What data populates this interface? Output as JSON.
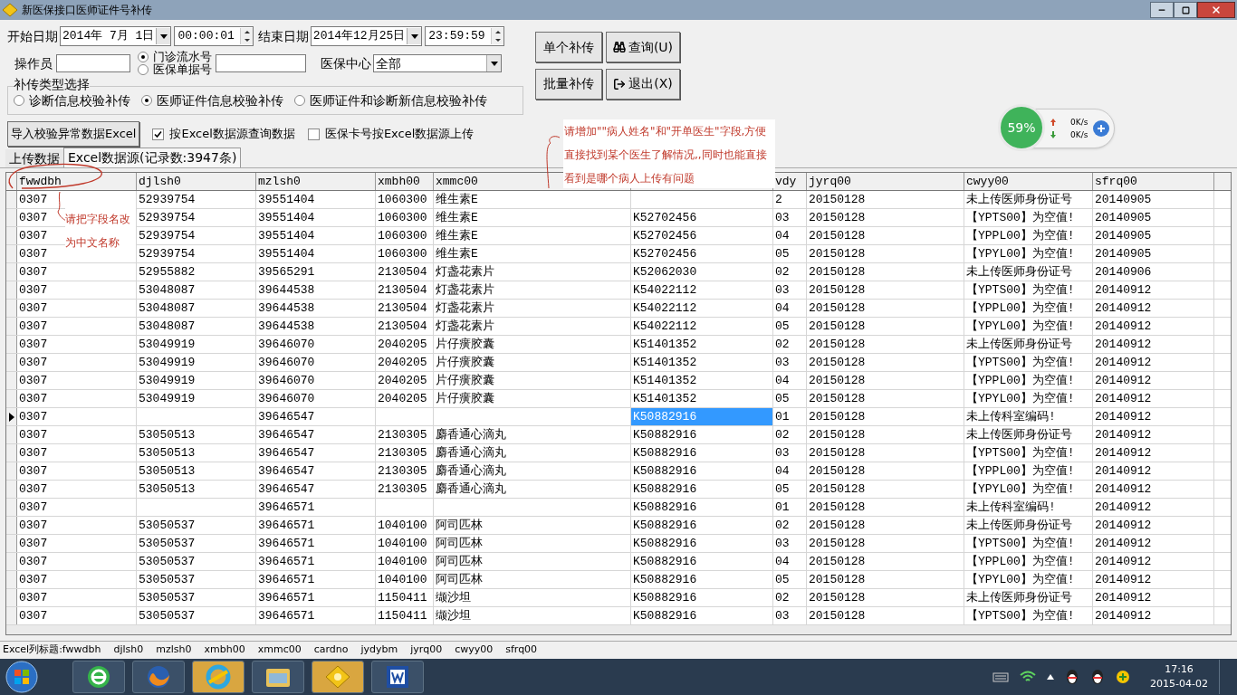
{
  "window": {
    "title": "新医保接口医师证件号补传"
  },
  "form": {
    "start": {
      "label": "开始日期",
      "date": "2014年 7月 1日",
      "time": "00:00:01"
    },
    "end": {
      "label": "结束日期",
      "date": "2014年12月25日",
      "time": "23:59:59"
    },
    "operator": {
      "label": "操作员"
    },
    "number_type": [
      {
        "label": "门诊流水号",
        "selected": true
      },
      {
        "label": "医保单据号",
        "selected": false
      }
    ],
    "center": {
      "label": "医保中心",
      "value": "全部"
    },
    "upload_type": {
      "title": "补传类型选择",
      "options": [
        {
          "label": "诊断信息校验补传",
          "selected": false
        },
        {
          "label": "医师证件信息校验补传",
          "selected": true
        },
        {
          "label": "医师证件和诊断新信息校验补传",
          "selected": false
        }
      ]
    },
    "import_button": "导入校验异常数据Excel",
    "checks": [
      {
        "label": "按Excel数据源查询数据",
        "checked": true
      },
      {
        "label": "医保卡号按Excel数据源上传",
        "checked": false
      }
    ]
  },
  "buttons": [
    {
      "label": "单个补传",
      "kind": "plain"
    },
    {
      "label": "查询(U)",
      "kind": "search"
    },
    {
      "label": "批量补传",
      "kind": "plain"
    },
    {
      "label": "退出(X)",
      "kind": "exit"
    }
  ],
  "net_widget": {
    "percent": "59%",
    "up": "0K/s",
    "down": "0K/s"
  },
  "tabs": [
    {
      "label": "上传数据",
      "selected": false
    },
    {
      "label": "Excel数据源(记录数:3947条)",
      "selected": true
    }
  ],
  "table": {
    "columns": [
      {
        "label": "fwwdbh",
        "focused": false
      },
      {
        "label": "djlsh0",
        "focused": false
      },
      {
        "label": "mzlsh0",
        "focused": false
      },
      {
        "label": "xmbh00",
        "focused": false
      },
      {
        "label": "xmmc00",
        "focused": false
      },
      {
        "focused": true
      },
      {
        "label": "vdy",
        "focused": false
      },
      {
        "label": "jyrq00",
        "focused": false
      },
      {
        "label": "cwyy00",
        "focused": false
      },
      {
        "label": "sfrq00",
        "focused": false
      }
    ],
    "rows": [
      {
        "current": false,
        "cells": [
          "0307",
          "52939754",
          "39551404",
          "1060300",
          "维生素E",
          null,
          "2",
          "20150128",
          "未上传医师身份证号",
          "20140905"
        ]
      },
      {
        "current": false,
        "cells": [
          "0307",
          "52939754",
          "39551404",
          "1060300",
          "维生素E",
          "K52702456",
          "03",
          "20150128",
          "【YPTS00】为空值!",
          "20140905"
        ]
      },
      {
        "current": false,
        "cells": [
          "0307",
          "52939754",
          "39551404",
          "1060300",
          "维生素E",
          "K52702456",
          "04",
          "20150128",
          "【YPPL00】为空值!",
          "20140905"
        ]
      },
      {
        "current": false,
        "cells": [
          "0307",
          "52939754",
          "39551404",
          "1060300",
          "维生素E",
          "K52702456",
          "05",
          "20150128",
          "【YPYL00】为空值!",
          "20140905"
        ]
      },
      {
        "current": false,
        "cells": [
          "0307",
          "52955882",
          "39565291",
          "2130504",
          "灯盏花素片",
          "K52062030",
          "02",
          "20150128",
          "未上传医师身份证号",
          "20140906"
        ]
      },
      {
        "current": false,
        "cells": [
          "0307",
          "53048087",
          "39644538",
          "2130504",
          "灯盏花素片",
          "K54022112",
          "03",
          "20150128",
          "【YPTS00】为空值!",
          "20140912"
        ]
      },
      {
        "current": false,
        "cells": [
          "0307",
          "53048087",
          "39644538",
          "2130504",
          "灯盏花素片",
          "K54022112",
          "04",
          "20150128",
          "【YPPL00】为空值!",
          "20140912"
        ]
      },
      {
        "current": false,
        "cells": [
          "0307",
          "53048087",
          "39644538",
          "2130504",
          "灯盏花素片",
          "K54022112",
          "05",
          "20150128",
          "【YPYL00】为空值!",
          "20140912"
        ]
      },
      {
        "current": false,
        "cells": [
          "0307",
          "53049919",
          "39646070",
          "2040205",
          "片仔癀胶囊",
          "K51401352",
          "02",
          "20150128",
          "未上传医师身份证号",
          "20140912"
        ]
      },
      {
        "current": false,
        "cells": [
          "0307",
          "53049919",
          "39646070",
          "2040205",
          "片仔癀胶囊",
          "K51401352",
          "03",
          "20150128",
          "【YPTS00】为空值!",
          "20140912"
        ]
      },
      {
        "current": false,
        "cells": [
          "0307",
          "53049919",
          "39646070",
          "2040205",
          "片仔癀胶囊",
          "K51401352",
          "04",
          "20150128",
          "【YPPL00】为空值!",
          "20140912"
        ]
      },
      {
        "current": false,
        "cells": [
          "0307",
          "53049919",
          "39646070",
          "2040205",
          "片仔癀胶囊",
          "K51401352",
          "05",
          "20150128",
          "【YPYL00】为空值!",
          "20140912"
        ]
      },
      {
        "current": true,
        "cells": [
          "0307",
          null,
          "39646547",
          null,
          null,
          "K50882916",
          "01",
          "20150128",
          "未上传科室编码!",
          "20140912"
        ]
      },
      {
        "current": false,
        "cells": [
          "0307",
          "53050513",
          "39646547",
          "2130305",
          "麝香通心滴丸",
          "K50882916",
          "02",
          "20150128",
          "未上传医师身份证号",
          "20140912"
        ]
      },
      {
        "current": false,
        "cells": [
          "0307",
          "53050513",
          "39646547",
          "2130305",
          "麝香通心滴丸",
          "K50882916",
          "03",
          "20150128",
          "【YPTS00】为空值!",
          "20140912"
        ]
      },
      {
        "current": false,
        "cells": [
          "0307",
          "53050513",
          "39646547",
          "2130305",
          "麝香通心滴丸",
          "K50882916",
          "04",
          "20150128",
          "【YPPL00】为空值!",
          "20140912"
        ]
      },
      {
        "current": false,
        "cells": [
          "0307",
          "53050513",
          "39646547",
          "2130305",
          "麝香通心滴丸",
          "K50882916",
          "05",
          "20150128",
          "【YPYL00】为空值!",
          "20140912"
        ]
      },
      {
        "current": false,
        "cells": [
          "0307",
          null,
          "39646571",
          null,
          null,
          "K50882916",
          "01",
          "20150128",
          "未上传科室编码!",
          "20140912"
        ]
      },
      {
        "current": false,
        "cells": [
          "0307",
          "53050537",
          "39646571",
          "1040100",
          "阿司匹林",
          "K50882916",
          "02",
          "20150128",
          "未上传医师身份证号",
          "20140912"
        ]
      },
      {
        "current": false,
        "cells": [
          "0307",
          "53050537",
          "39646571",
          "1040100",
          "阿司匹林",
          "K50882916",
          "03",
          "20150128",
          "【YPTS00】为空值!",
          "20140912"
        ]
      },
      {
        "current": false,
        "cells": [
          "0307",
          "53050537",
          "39646571",
          "1040100",
          "阿司匹林",
          "K50882916",
          "04",
          "20150128",
          "【YPPL00】为空值!",
          "20140912"
        ]
      },
      {
        "current": false,
        "cells": [
          "0307",
          "53050537",
          "39646571",
          "1040100",
          "阿司匹林",
          "K50882916",
          "05",
          "20150128",
          "【YPYL00】为空值!",
          "20140912"
        ]
      },
      {
        "current": false,
        "cells": [
          "0307",
          "53050537",
          "39646571",
          "1150411",
          "缬沙坦",
          "K50882916",
          "02",
          "20150128",
          "未上传医师身份证号",
          "20140912"
        ]
      },
      {
        "current": false,
        "cells": [
          "0307",
          "53050537",
          "39646571",
          "1150411",
          "缬沙坦",
          "K50882916",
          "03",
          "20150128",
          "【YPTS00】为空值!",
          "20140912"
        ]
      }
    ]
  },
  "annotations": [
    {
      "kind": "field-note",
      "text": "请把字段名改为中文名称"
    },
    {
      "kind": "request",
      "text": "请增加\"\"病人姓名\"和\"开单医生\"字段,方便直接找到某个医生了解情况,,同时也能直接看到是哪个病人上传有问题"
    }
  ],
  "status_bar": [
    "Excel列标题:fwwdbh",
    "djlsh0",
    "mzlsh0",
    "xmbh00",
    "xmmc00",
    "cardno",
    "jydybm",
    "jyrq00",
    "cwyy00",
    "sfrq00"
  ],
  "taskbar": {
    "apps": [
      {
        "kind": "ie"
      },
      {
        "kind": "firefox"
      },
      {
        "kind": "qq-browser"
      },
      {
        "kind": "explorer"
      },
      {
        "kind": "tool"
      },
      {
        "kind": "word"
      }
    ],
    "time": "17:16",
    "date": "2015-04-02"
  }
}
